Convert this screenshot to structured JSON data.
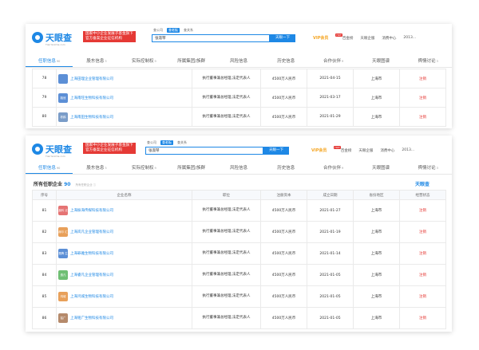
{
  "brand": {
    "name": "天眼查",
    "sub": "TianYanCha.com",
    "promo": [
      "国家中小企业发展子基金旗下",
      "官方备案企业征信机构"
    ]
  },
  "colors": {
    "accent": "#1e88e5",
    "revoked": "#e53935",
    "vip": "#f5a623"
  },
  "search": {
    "scope_tabs": [
      "查公司",
      "查老板",
      "查关系"
    ],
    "active_scope": 1,
    "value": "张淑琴",
    "button": "天眼一下"
  },
  "topnav": {
    "vip": "VIP会员",
    "items": [
      "百金榜",
      "天眼企服",
      "消费中心",
      "2013..."
    ],
    "hot": "HOT"
  },
  "tabs": [
    {
      "label": "任职信息",
      "count": "90"
    },
    {
      "label": "股东信息",
      "count": "3"
    },
    {
      "label": "实际控制权",
      "count": "9"
    },
    {
      "label": "所属集团/族群",
      "count": ""
    },
    {
      "label": "风险信息",
      "count": ""
    },
    {
      "label": "历史信息",
      "count": ""
    },
    {
      "label": "合作伙伴",
      "count": "9"
    },
    {
      "label": "天眼图谱",
      "count": ""
    },
    {
      "label": "舆情讨论",
      "count": "3"
    }
  ],
  "section": {
    "title": "所有任职企业",
    "count": "90",
    "sub": "所有任职企业 ⓘ",
    "logo": "天眼查"
  },
  "columns": [
    "序号",
    "企业名称",
    "职位",
    "注册资本",
    "成立日期",
    "省份地区",
    "经营状态"
  ],
  "top_rows": [
    {
      "no": "78",
      "logo_text": "",
      "logo_color": "#5c8fd6",
      "name": "上海田理企业管理有限公司",
      "role": "执行董事兼总经理,法定代表人",
      "capital": "4500万人民币",
      "date": "2021-04-15",
      "region": "上海市",
      "status": "注销"
    },
    {
      "no": "79",
      "logo_text": "路冠",
      "logo_color": "#5c8fd6",
      "name": "上海南旺生物科技有限公司",
      "role": "执行董事兼总经理,法定代表人",
      "capital": "4500万人民币",
      "date": "2021-03-17",
      "region": "上海市",
      "status": "注销"
    },
    {
      "no": "80",
      "logo_text": "彬鸥",
      "logo_color": "#7a9cc8",
      "name": "上海南田生物科技有限公司",
      "role": "执行董事兼总经理,法定代表人",
      "capital": "4500万人民币",
      "date": "2021-01-29",
      "region": "上海市",
      "status": "注销"
    }
  ],
  "bottom_rows": [
    {
      "no": "81",
      "logo_text": "鑫科 泛生",
      "logo_color": "#e57373",
      "name": "上海振海传媒科技有限公司",
      "role": "执行董事兼总经理,法定代表人",
      "capital": "4500万人民币",
      "date": "2021-01-27",
      "region": "上海市",
      "status": "注销"
    },
    {
      "no": "82",
      "logo_text": "赫尔 汇凡",
      "logo_color": "#e8a05a",
      "name": "上海岚凡企业管理有限公司",
      "role": "执行董事兼总经理,法定代表人",
      "capital": "4500万人民币",
      "date": "2021-01-19",
      "region": "上海市",
      "status": "注销"
    },
    {
      "no": "83",
      "logo_text": "晋腾 生物",
      "logo_color": "#5c8fd6",
      "name": "上海罪雅生物科技有限公司",
      "role": "执行董事兼总经理,法定代表人",
      "capital": "4500万人民币",
      "date": "2021-01-14",
      "region": "上海市",
      "status": "注销"
    },
    {
      "no": "84",
      "logo_text": "逸凡",
      "logo_color": "#6fbf73",
      "name": "上海睿凡企业管理有限公司",
      "role": "执行董事兼总经理,法定代表人",
      "capital": "4500万人民币",
      "date": "2021-01-05",
      "region": "上海市",
      "status": "注销"
    },
    {
      "no": "85",
      "logo_text": "鸿城",
      "logo_color": "#e8a05a",
      "name": "上海鸿城生物科技有限公司",
      "role": "执行董事兼总经理,法定代表人",
      "capital": "4500万人民币",
      "date": "2021-01-05",
      "region": "上海市",
      "status": "注销"
    },
    {
      "no": "86",
      "logo_text": "铭广",
      "logo_color": "#b58a6b",
      "name": "上海铭广生物科技有限公司",
      "role": "执行董事兼总经理,法定代表人",
      "capital": "4500万人民币",
      "date": "2021-01-05",
      "region": "上海市",
      "status": "注销"
    }
  ]
}
